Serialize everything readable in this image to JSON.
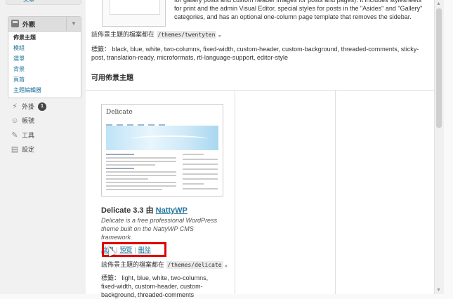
{
  "sidebar": {
    "cut_item_label": "文章",
    "appearance": {
      "label": "外觀",
      "toggle_icon": "triangle-down",
      "submenu": [
        {
          "label": "佈景主題",
          "current": true
        },
        {
          "label": "模組",
          "current": false
        },
        {
          "label": "選單",
          "current": false
        },
        {
          "label": "背景",
          "current": false
        },
        {
          "label": "頁首",
          "current": false
        },
        {
          "label": "主題編輯器",
          "current": false
        }
      ]
    },
    "plugins": {
      "label": "外掛",
      "badge": "1",
      "icon": "plug-icon"
    },
    "users": {
      "label": "帳號",
      "icon": "users-icon"
    },
    "tools": {
      "label": "工具",
      "icon": "tools-icon"
    },
    "settings": {
      "label": "設定",
      "icon": "settings-icon"
    }
  },
  "current_theme": {
    "description": "for gallery posts and custom header images for posts and pages). It includes stylesheets for print and the admin Visual Editor, special styles for posts in the \"Asides\" and \"Gallery\" categories, and has an optional one-column page template that removes the sidebar.",
    "path_prefix": "該佈景主題的檔案都在",
    "path": "/themes/twentyten",
    "path_suffix": "。",
    "tags_label": "標籤：",
    "tags": "black, blue, white, two-columns, fixed-width, custom-header, custom-background, threaded-comments, sticky-post, translation-ready, microformats, rtl-language-support, editor-style"
  },
  "available": {
    "section_title": "可用佈景主題",
    "theme": {
      "preview_logo": "Delicate",
      "name_version": "Delicate 3.3",
      "by": "由",
      "author": "NattyWP",
      "description": "Delicate is a free professional WordPress theme built on the NattyWP CMS framework.",
      "actions": {
        "activate": "啟用",
        "preview": "預覽",
        "delete": "刪除",
        "separator": "|"
      },
      "path_prefix": "該佈景主題的檔案都在",
      "path": "/themes/delicate",
      "path_suffix": "。",
      "tags_label": "標籤：",
      "tags": "light, blue, white, two-columns, fixed-width, custom-header, custom-background, threaded-comments"
    }
  },
  "colors": {
    "link": "#21759b",
    "highlight": "#e00000"
  }
}
